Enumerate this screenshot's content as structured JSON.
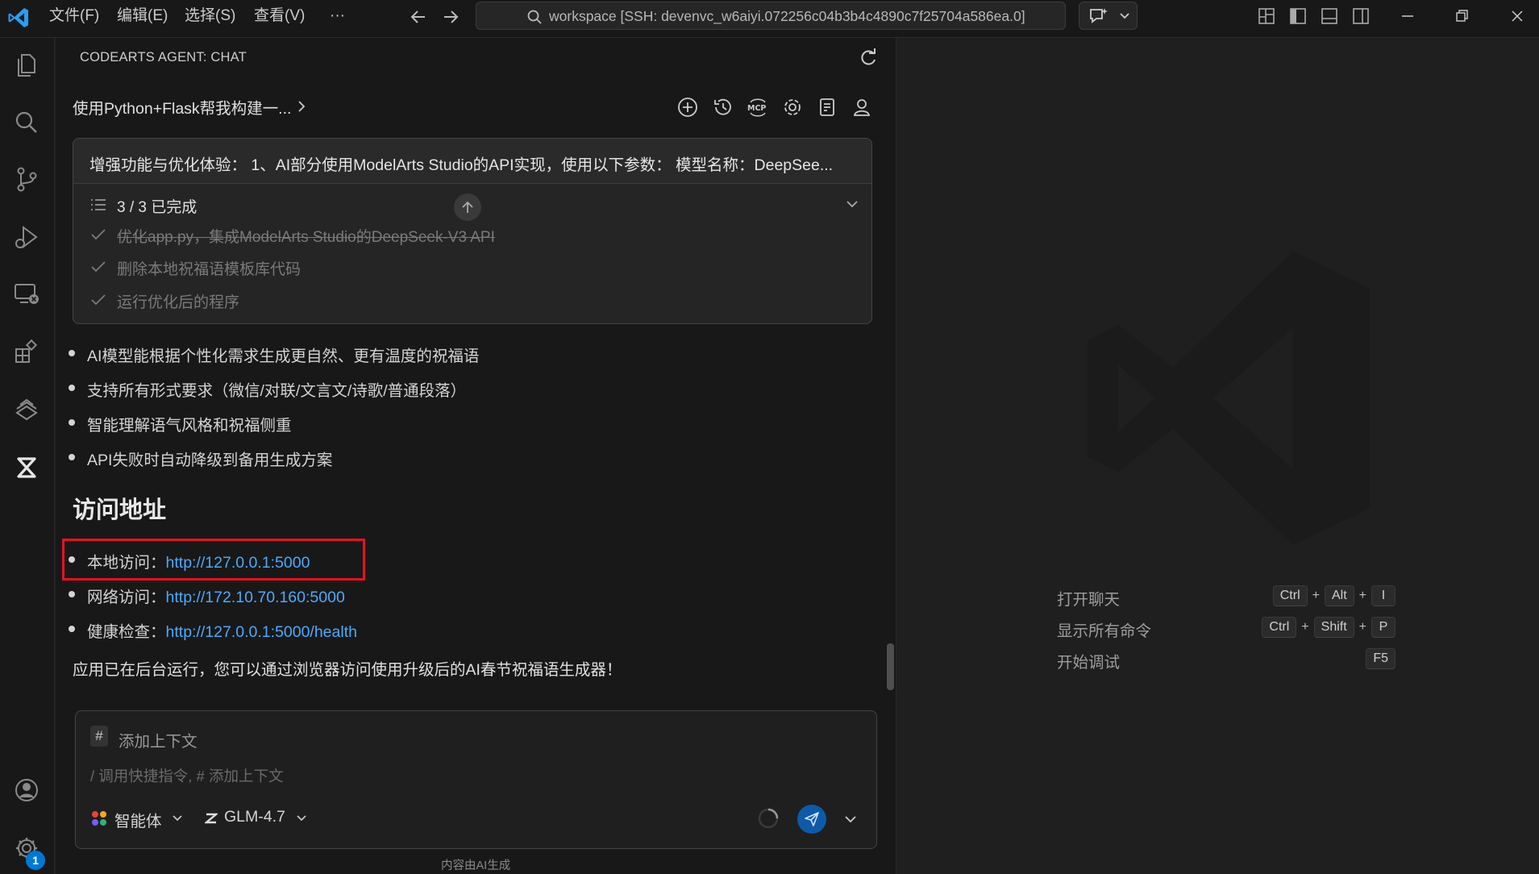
{
  "titlebar": {
    "menus": [
      "文件(F)",
      "编辑(E)",
      "选择(S)",
      "查看(V)",
      "···"
    ],
    "search_text": "workspace [SSH: devenvc_w6aiyi.072256c04b3b4c4890c7f25704a586ea.0]"
  },
  "chat": {
    "panel_title": "CODEARTS AGENT: CHAT",
    "conversation_title": "使用Python+Flask帮我构建一...",
    "task_card": {
      "header": "增强功能与优化体验： 1、AI部分使用ModelArts Studio的API实现，使用以下参数： 模型名称：DeepSee...",
      "progress": "3 / 3 已完成",
      "tasks": [
        "优化app.py，集成ModelArts Studio的DeepSeek-V3 API",
        "删除本地祝福语模板库代码",
        "运行优化后的程序"
      ]
    },
    "features": [
      "AI模型能根据个性化需求生成更自然、更有温度的祝福语",
      "支持所有形式要求（微信/对联/文言文/诗歌/普通段落）",
      "智能理解语气风格和祝福侧重",
      "API失败时自动降级到备用生成方案"
    ],
    "access_heading": "访问地址",
    "access": [
      {
        "label": "本地访问：",
        "url": "http://127.0.0.1:5000"
      },
      {
        "label": "网络访问：",
        "url": "http://172.10.70.160:5000"
      },
      {
        "label": "健康检查：",
        "url": "http://127.0.0.1:5000/health"
      }
    ],
    "final_text": "应用已在后台运行，您可以通过浏览器访问使用升级后的AI春节祝福语生成器！",
    "input": {
      "hash": "#",
      "context_label": "添加上下文",
      "placeholder": "/ 调用快捷指令, # 添加上下文",
      "agent_label": "智能体",
      "model_label": "GLM-4.7"
    },
    "footer_note": "内容由AI生成"
  },
  "activity": {
    "settings_badge": "1"
  },
  "welcome": {
    "shortcuts": [
      {
        "label": "打开聊天",
        "keys": [
          "Ctrl",
          "Alt",
          "I"
        ]
      },
      {
        "label": "显示所有命令",
        "keys": [
          "Ctrl",
          "Shift",
          "P"
        ]
      },
      {
        "label": "开始调试",
        "keys": [
          "F5"
        ]
      }
    ]
  },
  "colors": {
    "accent": "#0078d4",
    "link": "#4daafc",
    "highlight_border": "#e81123"
  }
}
